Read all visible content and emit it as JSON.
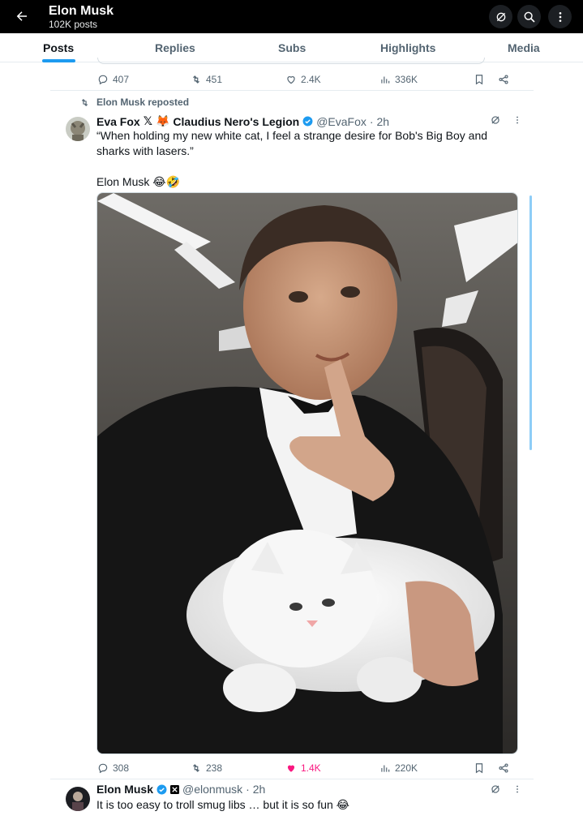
{
  "header": {
    "title": "Elon Musk",
    "subtitle": "102K posts",
    "icons": [
      "back-arrow-icon",
      "grok-icon",
      "search-icon",
      "more-vertical-icon"
    ]
  },
  "tabs": [
    {
      "label": "Posts",
      "active": true
    },
    {
      "label": "Replies",
      "active": false
    },
    {
      "label": "Subs",
      "active": false
    },
    {
      "label": "Highlights",
      "active": false
    },
    {
      "label": "Media",
      "active": false
    }
  ],
  "prev_post_actions": {
    "replies": "407",
    "reposts": "451",
    "likes": "2.4K",
    "views": "336K"
  },
  "repost": {
    "label": "Elon Musk reposted",
    "author_name": "Eva Fox",
    "author_name_extra": "Claudius Nero's Legion",
    "author_handle": "@EvaFox",
    "time": "· 2h",
    "text_line1": "“When holding my new white cat, I feel a strange desire for Bob's Big Boy and",
    "text_line2": "sharks with lasers.”",
    "text_line3": "Elon Musk 😂🤣",
    "actions": {
      "replies": "308",
      "reposts": "238",
      "likes": "1.4K",
      "views": "220K",
      "liked": true
    }
  },
  "next_post": {
    "author_name": "Elon Musk",
    "author_handle": "@elonmusk",
    "time": "· 2h",
    "text": "It is too easy to troll smug libs … but it is so fun 😂"
  },
  "colors": {
    "accent": "#1d9bf0",
    "like": "#f91880",
    "muted": "#536471"
  }
}
